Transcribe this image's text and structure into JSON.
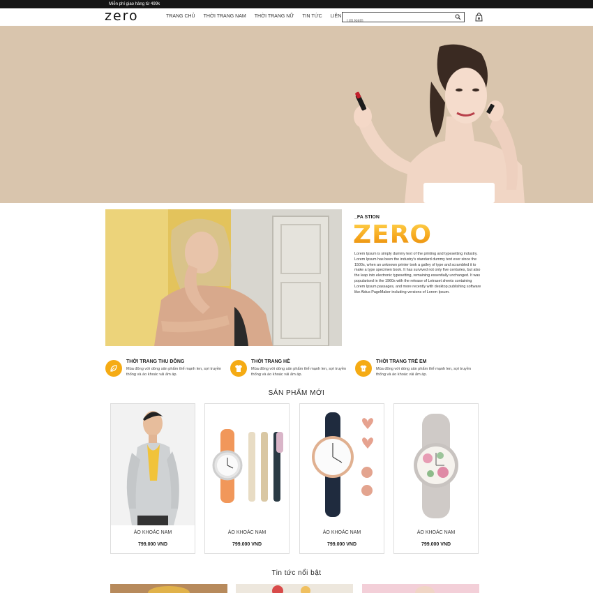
{
  "topbar": {
    "text": "Miễn phí giao hàng từ 499k"
  },
  "header": {
    "logo": "zero",
    "nav": [
      "TRANG CHỦ",
      "THỜI TRANG NAM",
      "THỜI TRANG NỮ",
      "TIN TỨC",
      "LIÊN HỆ"
    ],
    "search_placeholder": "Tìm kiếm"
  },
  "about": {
    "subtitle": "_FA STION",
    "title": "ZERO",
    "text": "Lorem Ipsum is simply dummy text of the printing and typesetting industry. Lorem Ipsum has been the industry's standard dummy text ever since the 1500s, when an unknown printer took a galley of type and scrambled it to make a type specimen book. It has survived not only five centuries, but also the leap into electronic typesetting, remaining essentially unchanged. It was popularised in the 1960s with the release of Letraset sheets containing Lorem Ipsum passages, and more recently with desktop publishing software like Aldus PageMaker including versions of Lorem Ipsum."
  },
  "features": [
    {
      "title": "THỜI TRANG THU ĐÔNG",
      "desc": "Mùa đông với dòng sản phẩm thể mạnh len, sợi truyền thống và áo khoác vải ấm áp.",
      "icon": "leaf-icon"
    },
    {
      "title": "THỜI TRANG HÈ",
      "desc": "Mùa đông với dòng sản phẩm thể mạnh len, sợi truyền thống và áo khoác vải ấm áp.",
      "icon": "tshirt-icon"
    },
    {
      "title": "THỜI TRANG TRẺ EM",
      "desc": "Mùa đông với dòng sản phẩm thể mạnh len, sợi truyền thống và áo khoác vải ấm áp.",
      "icon": "baby-shirt-icon"
    }
  ],
  "products_section": {
    "title": "SẢN PHẨM MỚI"
  },
  "products": [
    {
      "name": "ÁO KHOÁC NAM",
      "price": "799.000 VND"
    },
    {
      "name": "ÁO KHOÁC NAM",
      "price": "799.000 VND"
    },
    {
      "name": "ÁO KHOÁC NAM",
      "price": "799.000 VND"
    },
    {
      "name": "ÁO KHOÁC NAM",
      "price": "799.000 VND"
    }
  ],
  "news_section": {
    "title": "Tin tức nổi bật"
  },
  "colors": {
    "accent": "#f5ab14",
    "hero_bg": "#d9c5ad",
    "topbar": "#151515"
  }
}
